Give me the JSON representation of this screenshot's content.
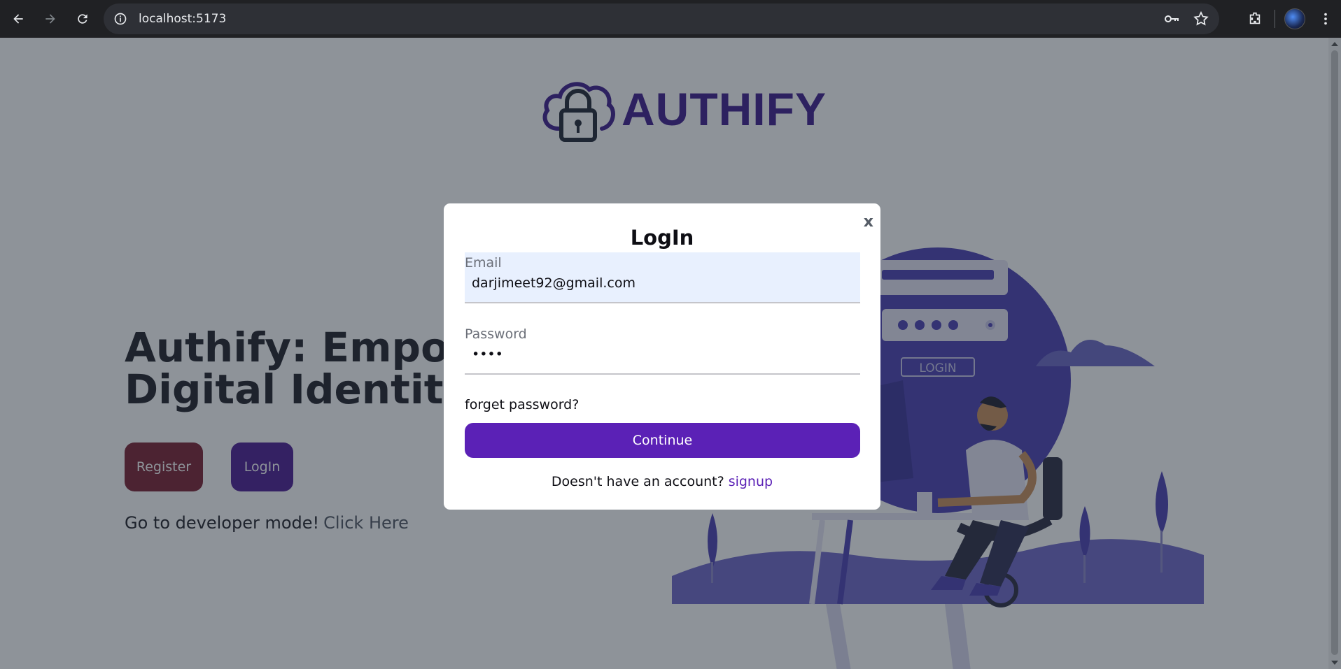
{
  "browser": {
    "url": "localhost:5173",
    "icons": [
      "back-icon",
      "forward-icon",
      "reload-icon",
      "site-info-icon",
      "password-key-icon",
      "bookmark-star-icon",
      "extensions-icon",
      "profile-avatar",
      "more-menu-icon"
    ]
  },
  "page": {
    "brand": "AUTHIFY",
    "hero_title_line1": "Authify: Empowe",
    "hero_title_line2": "Digital Identity S",
    "register_label": "Register",
    "login_label": "LogIn",
    "dev_text": "Go to developer mode!",
    "dev_link": "Click Here",
    "illustration_login_text": "LOGIN"
  },
  "modal": {
    "close_label": "x",
    "title": "LogIn",
    "email_label": "Email",
    "email_value": "darjimeet92@gmail.com",
    "password_label": "Password",
    "password_value": "••••",
    "forget_label": "forget password?",
    "continue_label": "Continue",
    "signup_prompt": "Doesn't have an account?",
    "signup_link": "signup"
  },
  "colors": {
    "brand_purple": "#3c1a8c",
    "continue_bg": "#5b21b6",
    "register_bg": "#7a1f30",
    "login_bg": "#4b1a93",
    "email_autofill_bg": "#e8f0fe"
  }
}
